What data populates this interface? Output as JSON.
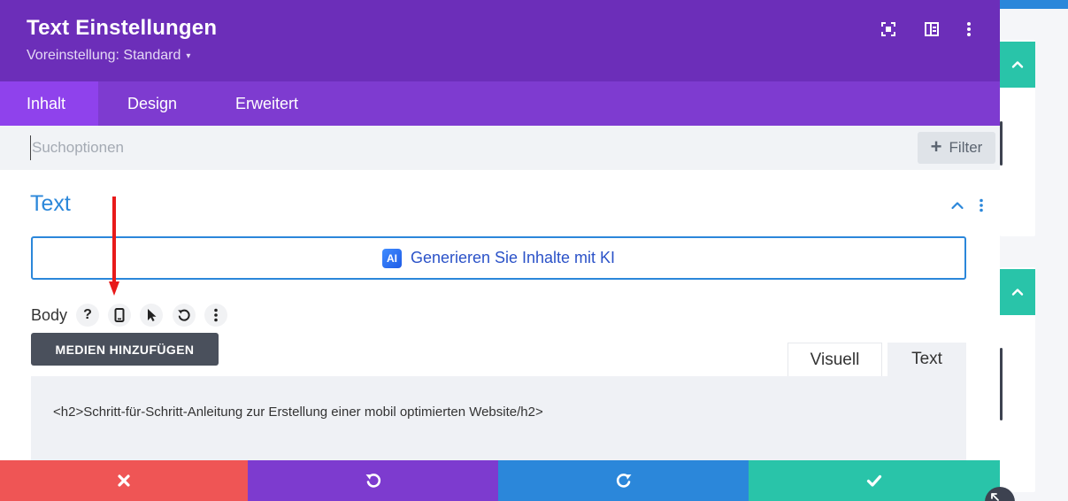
{
  "modal": {
    "title": "Text Einstellungen",
    "preset_label": "Voreinstellung: Standard",
    "preset_caret": "▾",
    "header_icons": [
      "focus-icon",
      "split-view-icon",
      "more-vertical-icon"
    ]
  },
  "tabs": [
    {
      "label": "Inhalt",
      "active": true
    },
    {
      "label": "Design",
      "active": false
    },
    {
      "label": "Erweitert",
      "active": false
    }
  ],
  "search": {
    "placeholder": "Suchoptionen",
    "value": "",
    "filter_label": "Filter",
    "filter_symbol": "+"
  },
  "section": {
    "title": "Text",
    "ai_button_label": "Generieren Sie Inhalte mit KI",
    "ai_badge": "AI"
  },
  "body_field": {
    "label": "Body",
    "help_symbol": "?",
    "tools": [
      "help-icon",
      "mobile-icon",
      "pointer-icon",
      "reset-icon",
      "more-vertical-icon"
    ]
  },
  "editor": {
    "media_button_label": "MEDIEN HINZUFÜGEN",
    "tab_visual": "Visuell",
    "tab_text": "Text",
    "active_tab": "Text",
    "content": "<h2>Schritt-für-Schritt-Anleitung zur Erstellung einer mobil optimierten Website/h2>"
  },
  "bottom_bar": {
    "buttons": [
      "close-icon",
      "undo-icon",
      "redo-icon",
      "check-icon"
    ]
  },
  "colors": {
    "header": "#6c2eb9",
    "tabs_bar": "#7e3bd0",
    "active_tab": "#8f42ec",
    "accent_blue": "#2b87da",
    "close_red": "#ef5555",
    "save_teal": "#29c4a9",
    "annotation_arrow": "#e81a1a"
  }
}
